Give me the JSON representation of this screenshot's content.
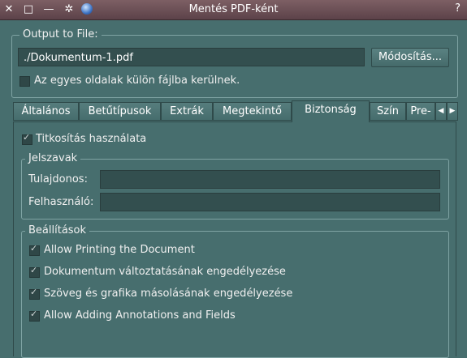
{
  "window": {
    "title": "Mentés PDF-ként",
    "close_glyph": "✕",
    "maximize_glyph": "□",
    "minimize_glyph": "—",
    "settings_glyph": "✲",
    "help_glyph": "?"
  },
  "output": {
    "group_label": "Output to File:",
    "path_value": "./Dokumentum-1.pdf",
    "browse_button": "Módosítás...",
    "separate_files_label": "Az egyes oldalak külön fájlba kerülnek.",
    "separate_files_checked": false
  },
  "tabs": [
    {
      "label": "Általános"
    },
    {
      "label": "Betűtípusok"
    },
    {
      "label": "Extrák"
    },
    {
      "label": "Megtekintő"
    },
    {
      "label": "Biztonság",
      "active": true
    },
    {
      "label": "Szín"
    },
    {
      "label": "Pre-"
    }
  ],
  "tab_arrows": {
    "left": "◀",
    "right": "▶"
  },
  "security": {
    "encryption_label": "Titkosítás használata",
    "encryption_checked": true,
    "passwords": {
      "group_label": "Jelszavak",
      "owner_label": "Tulajdonos:",
      "owner_value": "",
      "user_label": "Felhasználó:",
      "user_value": ""
    },
    "settings": {
      "group_label": "Beállítások",
      "items": [
        {
          "label": "Allow Printing the Document",
          "checked": true
        },
        {
          "label": "Dokumentum változtatásának engedélyezése",
          "checked": true
        },
        {
          "label": "Szöveg és grafika másolásának engedélyezése",
          "checked": true
        },
        {
          "label": "Allow Adding Annotations and Fields",
          "checked": true
        }
      ]
    }
  }
}
